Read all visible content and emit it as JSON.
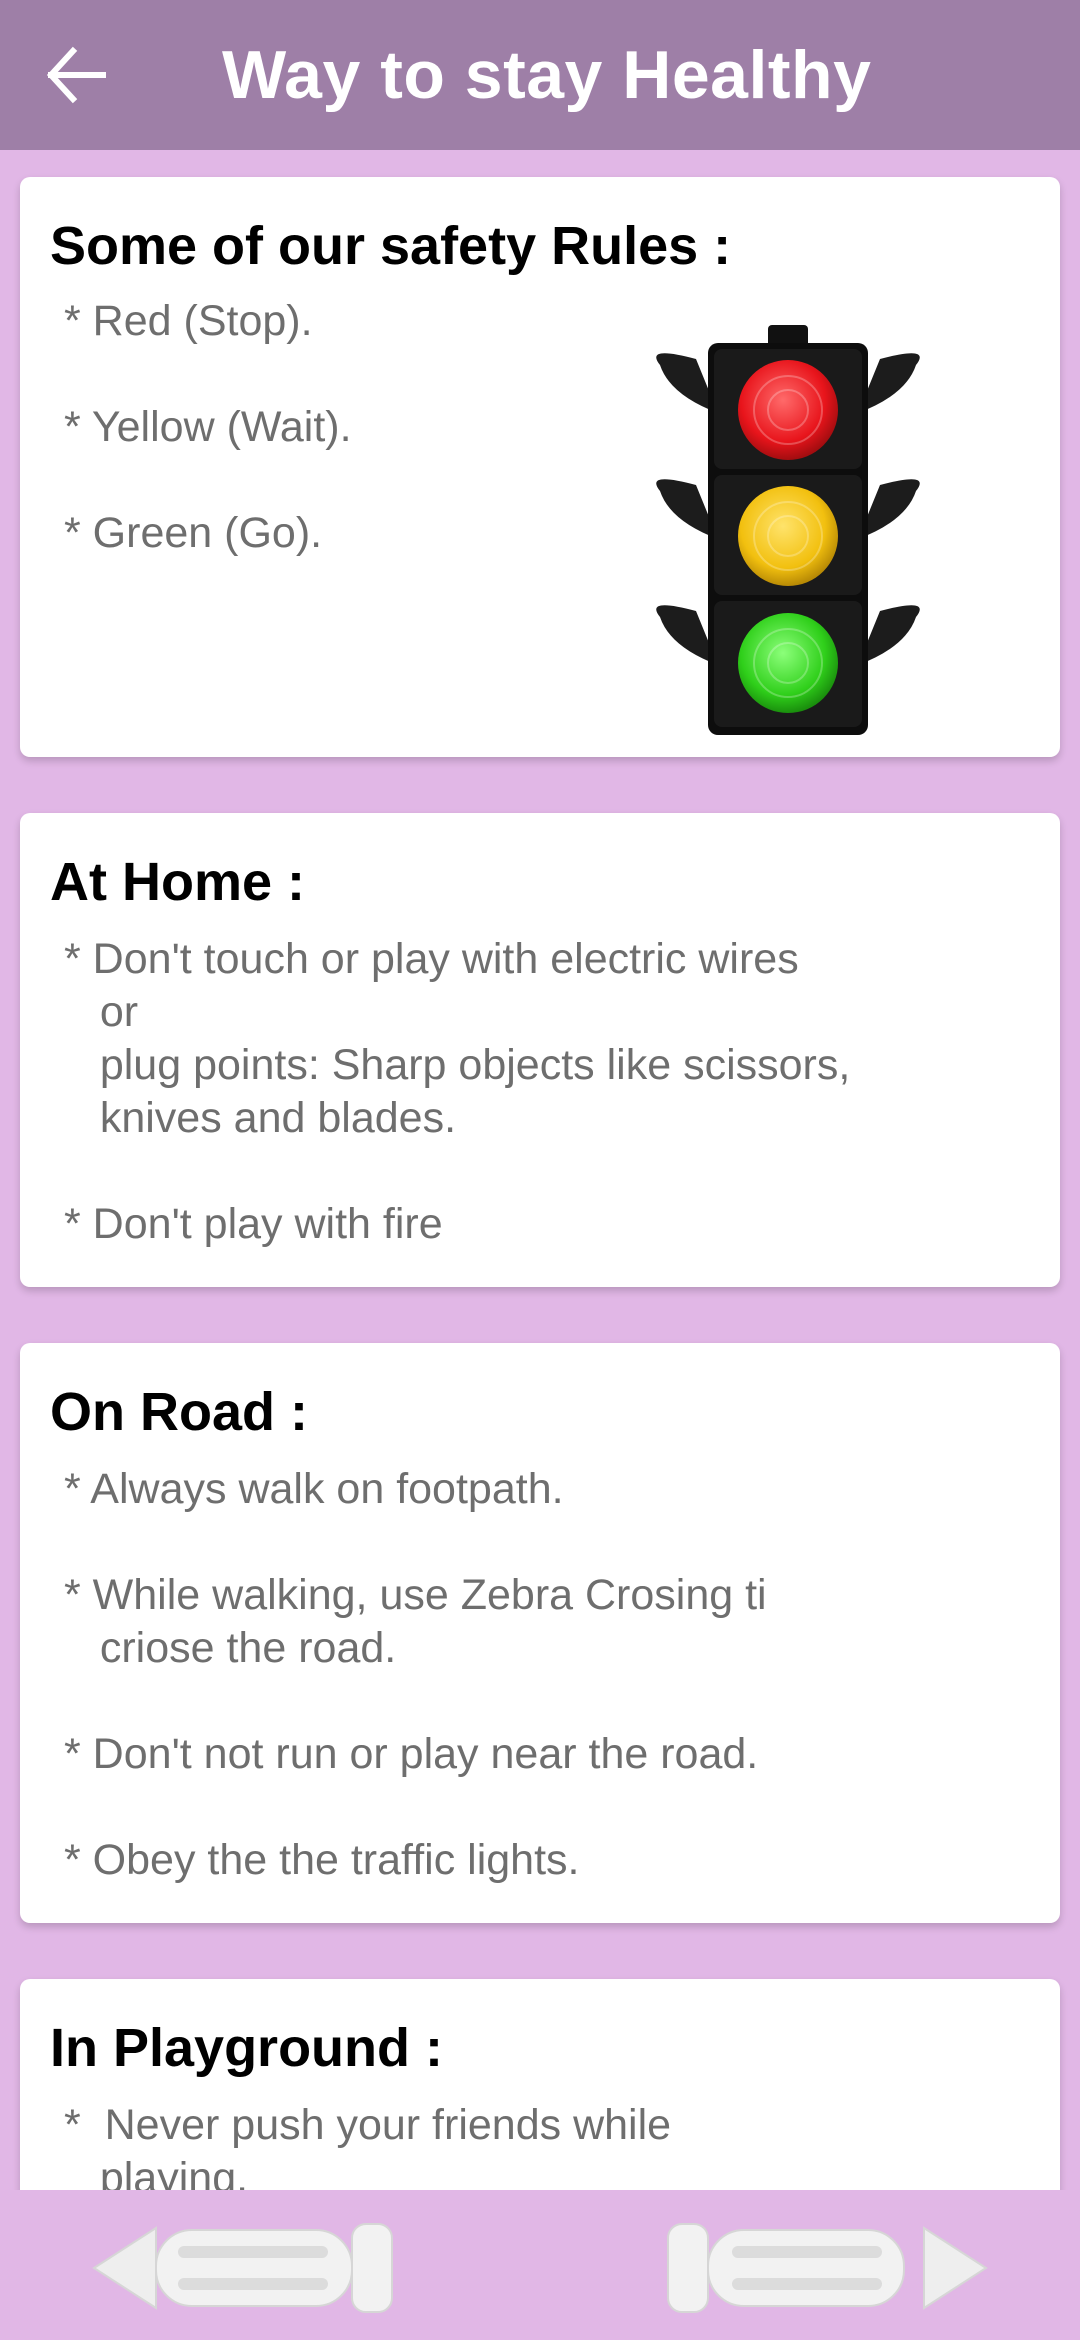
{
  "app_bar": {
    "title": "Way to stay Healthy",
    "back_icon": "arrow-left-icon"
  },
  "cards": {
    "safety": {
      "title": "Some of our safety Rules :",
      "items": [
        "* Red (Stop).",
        "* Yellow (Wait).",
        "* Green (Go)."
      ],
      "image": "traffic-light-icon",
      "light_colors": [
        "#e8141b",
        "#f2c00f",
        "#2fcf1a"
      ]
    },
    "home": {
      "title": "At Home :",
      "item1": "* Don't touch or play with electric wires\n   or\n   plug points: Sharp objects like scissors,\n   knives and blades.",
      "item2": "* Don't play with fire"
    },
    "road": {
      "title": "On Road :",
      "item1": "* Always walk on footpath.",
      "item2": "* While walking, use Zebra Crosing ti\n   criose the road.",
      "item3": "* Don't not run or play near the road.",
      "item4": "* Obey the the traffic lights."
    },
    "playground": {
      "title": "In Playground :",
      "item1": "*  Never push your friends while\n   playing."
    }
  },
  "bottom_nav": {
    "prev_icon": "previous-arrow-icon",
    "next_icon": "next-arrow-icon"
  },
  "colors": {
    "app_bar": "#9e7fa7",
    "background": "#e1b7e6",
    "card": "#ffffff",
    "title_text": "#000000",
    "body_text": "#6e6e6e"
  }
}
